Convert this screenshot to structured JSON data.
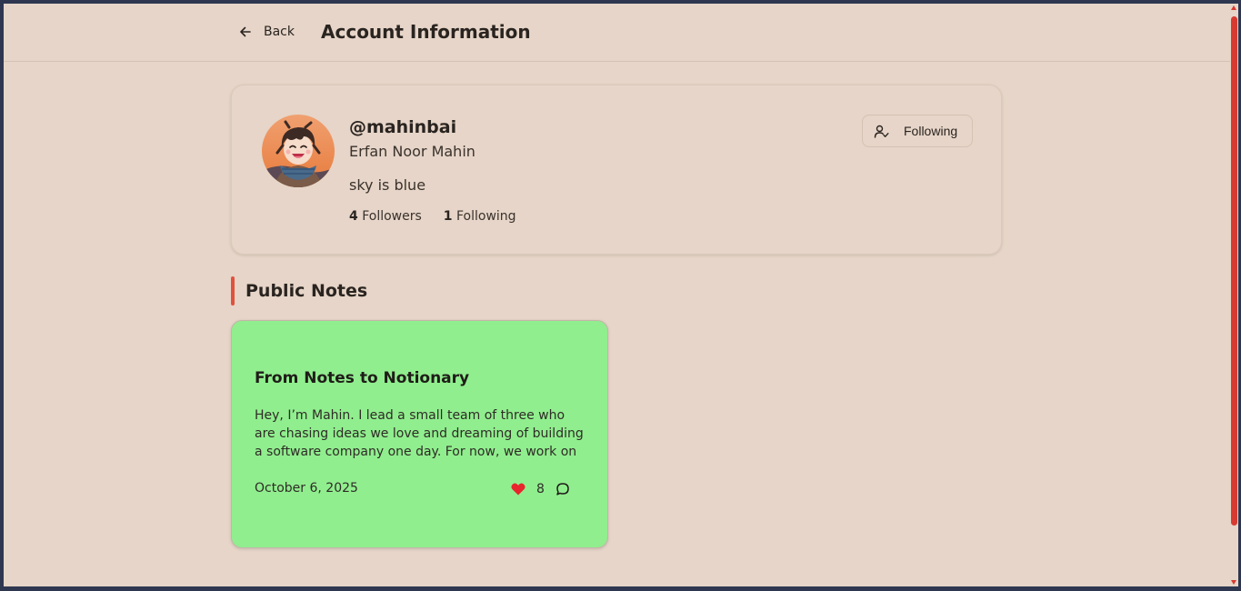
{
  "header": {
    "back_label": "Back",
    "title": "Account Information"
  },
  "profile": {
    "handle": "@mahinbai",
    "full_name": "Erfan Noor Mahin",
    "bio": "sky is blue",
    "followers_count": "4",
    "followers_label": "Followers",
    "following_count": "1",
    "following_label": "Following",
    "follow_button_label": "Following"
  },
  "section": {
    "title": "Public Notes"
  },
  "notes": [
    {
      "title": "From Notes to Notionary",
      "excerpt": "Hey, I’m Mahin. I lead a small team of three who are chasing ideas we love and dreaming of building a software company one day. For now, we work on our...",
      "date": "October 6, 2025",
      "likes": "8"
    }
  ],
  "icons": {
    "back": "arrow-left-icon",
    "follow": "user-check-icon",
    "like": "heart-icon",
    "comment": "comment-icon"
  },
  "colors": {
    "background": "#e6d5c8",
    "accent": "#e0523e",
    "note_card": "#90ee8e",
    "heart": "#e8252d",
    "scrollbar": "#d63a30"
  }
}
